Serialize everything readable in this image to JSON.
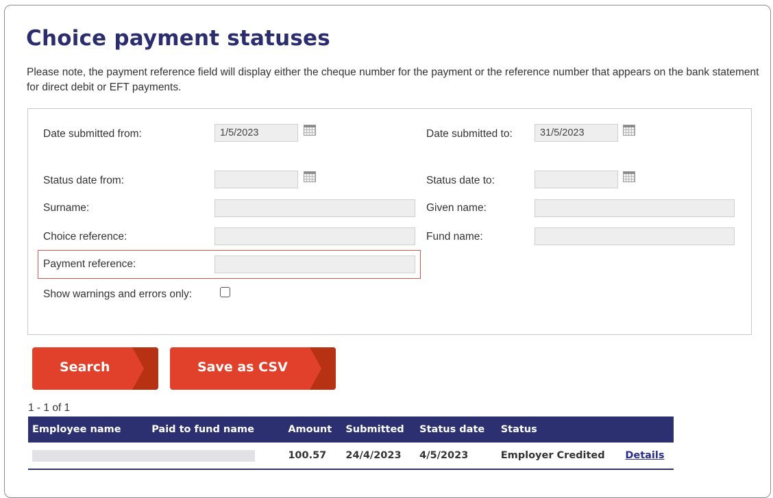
{
  "page": {
    "title": "Choice payment statuses",
    "note": "Please note, the payment reference field will display either the cheque number for the payment or the reference number that appears on the bank statement for direct debit or EFT payments."
  },
  "filters": {
    "date_submitted_from": {
      "label": "Date submitted from:",
      "value": "1/5/2023"
    },
    "date_submitted_to": {
      "label": "Date submitted to:",
      "value": "31/5/2023"
    },
    "status_date_from": {
      "label": "Status date from:",
      "value": ""
    },
    "status_date_to": {
      "label": "Status date to:",
      "value": ""
    },
    "surname": {
      "label": "Surname:",
      "value": ""
    },
    "given_name": {
      "label": "Given name:",
      "value": ""
    },
    "choice_reference": {
      "label": "Choice reference:",
      "value": ""
    },
    "fund_name": {
      "label": "Fund name:",
      "value": ""
    },
    "payment_reference": {
      "label": "Payment reference:",
      "value": ""
    },
    "show_warnings": {
      "label": "Show warnings and errors only:",
      "checked": false
    }
  },
  "buttons": {
    "search": "Search",
    "save_csv": "Save as CSV"
  },
  "results": {
    "count_text": "1 - 1 of 1",
    "columns": [
      "Employee name",
      "Paid to fund name",
      "Amount",
      "Submitted",
      "Status date",
      "Status"
    ],
    "rows": [
      {
        "employee_name": "",
        "paid_to_fund_name": "",
        "amount": "100.57",
        "submitted": "24/4/2023",
        "status_date": "4/5/2023",
        "status": "Employer Credited",
        "details_link": "Details"
      }
    ]
  },
  "colors": {
    "title": "#2b2d6e",
    "button": "#e1402b",
    "button_arrow": "#b73212",
    "table_header": "#2d3070",
    "highlight_border": "#d9534f"
  }
}
